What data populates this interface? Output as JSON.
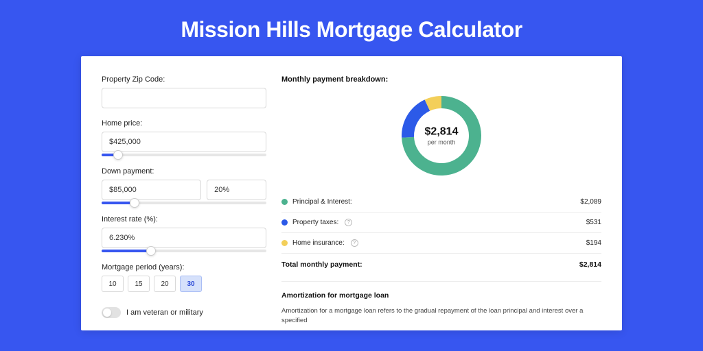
{
  "page_title": "Mission Hills Mortgage Calculator",
  "left": {
    "zip_label": "Property Zip Code:",
    "zip_value": "",
    "home_price_label": "Home price:",
    "home_price_value": "$425,000",
    "home_price_slider_pct": 10,
    "down_payment_label": "Down payment:",
    "down_payment_value": "$85,000",
    "down_payment_pct": "20%",
    "down_payment_slider_pct": 20,
    "interest_label": "Interest rate (%):",
    "interest_value": "6.230%",
    "interest_slider_pct": 30,
    "period_label": "Mortgage period (years):",
    "periods": [
      "10",
      "15",
      "20",
      "30"
    ],
    "period_active_index": 3,
    "veteran_label": "I am veteran or military"
  },
  "right": {
    "breakdown_title": "Monthly payment breakdown:",
    "donut_amount": "$2,814",
    "donut_sub": "per month",
    "legend": [
      {
        "label": "Principal & Interest:",
        "value": "$2,089",
        "color": "#4cb28f",
        "info": false
      },
      {
        "label": "Property taxes:",
        "value": "$531",
        "color": "#2c5ae8",
        "info": true
      },
      {
        "label": "Home insurance:",
        "value": "$194",
        "color": "#f3cf5a",
        "info": true
      }
    ],
    "total_label": "Total monthly payment:",
    "total_value": "$2,814",
    "amort_title": "Amortization for mortgage loan",
    "amort_text": "Amortization for a mortgage loan refers to the gradual repayment of the loan principal and interest over a specified"
  },
  "chart_data": {
    "type": "pie",
    "title": "Monthly payment breakdown",
    "series": [
      {
        "name": "Principal & Interest",
        "value": 2089,
        "color": "#4cb28f"
      },
      {
        "name": "Property taxes",
        "value": 531,
        "color": "#2c5ae8"
      },
      {
        "name": "Home insurance",
        "value": 194,
        "color": "#f3cf5a"
      }
    ],
    "total": 2814,
    "center_label": "$2,814 per month"
  }
}
